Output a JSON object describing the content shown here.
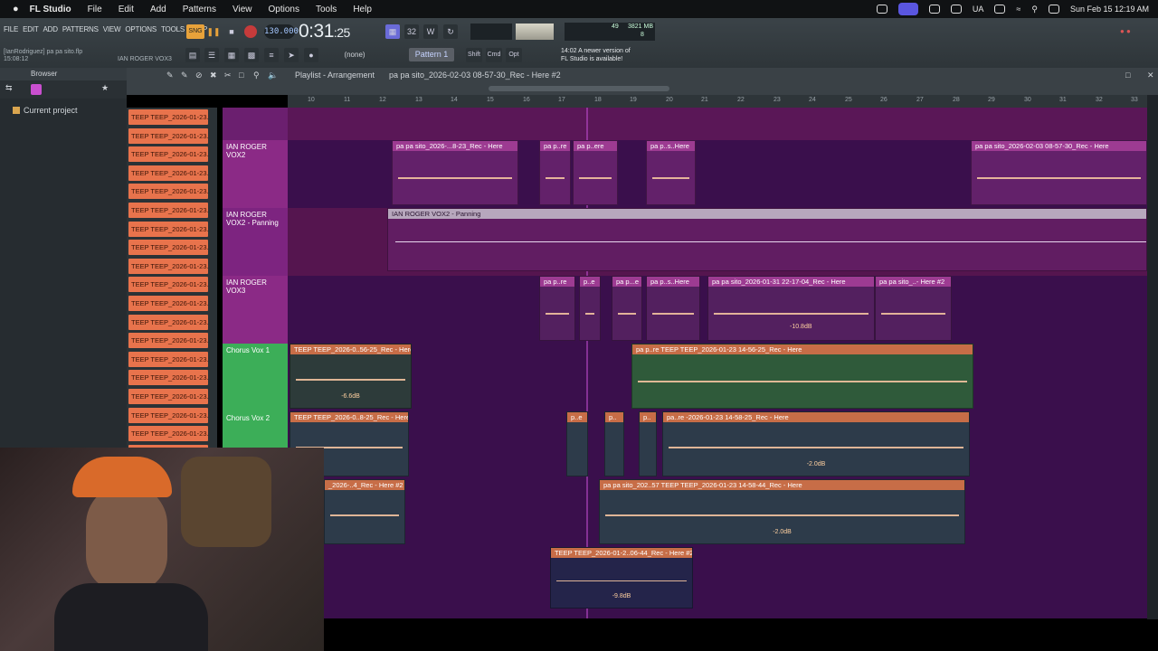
{
  "mac": {
    "app": "FL Studio",
    "menus": [
      "File",
      "Edit",
      "Add",
      "Patterns",
      "View",
      "Options",
      "Tools",
      "Help"
    ],
    "lang": "UA",
    "clock": "Sun Feb 15  12:19 AM"
  },
  "fl": {
    "menu": [
      "FILE",
      "EDIT",
      "ADD",
      "PATTERNS",
      "VIEW",
      "OPTIONS",
      "TOOLS",
      "HELP"
    ],
    "tempo": "130.000",
    "time_main": "0:31",
    "time_sub": ":25",
    "cpu": "49",
    "mem": "3821 MB",
    "poly": "8",
    "pattern": "Pattern 1",
    "snap": "(none)",
    "shift": "Shift",
    "ctrl": "Cmd",
    "opt": "Opt",
    "notice_time": "14:02",
    "notice_line1": "A newer version of",
    "notice_line2": "FL Studio is available!",
    "hint_user": "[IanRodriguez] pa pa sito.flp",
    "hint_time": "15:08:12",
    "hint_track": "IAN ROGER VOX3"
  },
  "browser": {
    "title": "Browser",
    "item": "Current project"
  },
  "playlist": {
    "title": "Playlist - Arrangement",
    "subtitle": "pa pa sito_2026-02-03 08-57-30_Rec - Here #2",
    "ruler": [
      "10",
      "11",
      "12",
      "13",
      "14",
      "15",
      "16",
      "17",
      "18",
      "19",
      "20",
      "21",
      "22",
      "23",
      "24",
      "25",
      "26",
      "27",
      "28",
      "29",
      "30",
      "31",
      "32",
      "33"
    ]
  },
  "patterns": [
    "TEEP TEEP_2026-01-23...",
    "TEEP TEEP_2026-01-23...",
    "TEEP TEEP_2026-01-23...",
    "TEEP TEEP_2026-01-23...",
    "TEEP TEEP_2026-01-23...",
    "TEEP TEEP_2026-01-23...",
    "TEEP TEEP_2026-01-23...",
    "TEEP TEEP_2026-01-23...",
    "TEEP TEEP_2026-01-23...",
    "TEEP TEEP_2026-01-23...",
    "TEEP TEEP_2026-01-23...",
    "TEEP TEEP_2026-01-23...",
    "TEEP TEEP_2026-01-23...",
    "TEEP TEEP_2026-01-23...",
    "TEEP TEEP_2026-01-23...",
    "TEEP TEEP_2026-01-23...",
    "TEEP TEEP_2026-01-23...",
    "TEEP TEEP_2026-01-23...",
    "TEEP TEEP_2026-01-23..."
  ],
  "tracks": {
    "t1": "IAN ROGER VOX2",
    "t2": "IAN ROGER VOX2 - Panning",
    "t3": "IAN ROGER VOX3",
    "t4": "Chorus Vox 1",
    "t5": "Chorus Vox 2"
  },
  "clips": {
    "c1": "pa pa sito_2026-...8-23_Rec - Here",
    "c2": "pa p..re",
    "c3": "pa p..ere",
    "c4": "pa p..s..Here",
    "c5": "pa pa sito_2026-02-03 08-57-30_Rec - Here",
    "auto": "IAN ROGER VOX2 - Panning",
    "c6": "pa p..re",
    "c7": "p..e",
    "c8": "pa p...e",
    "c9": "pa p..s..Here",
    "c10": "pa pa sito_2026-01-31 22-17-04_Rec - Here",
    "c11": "pa pa sito_..- Here #2",
    "c11_db": "-10.8dB",
    "c12": "TEEP TEEP_2026-0..56-25_Rec - Here",
    "c12_db": "-6.6dB",
    "c13": "pa p..re",
    "c14": "TEEP TEEP_2026-01-23 14-56-25_Rec - Here",
    "c15": "TEEP TEEP_2026-0..8-25_Rec - Here",
    "c16": "p..e",
    "c17": "p..",
    "c18": "p..",
    "c19": "pa..re",
    "c20": "-2026-01-23 14-58-25_Rec - Here",
    "c20_db": "-2.0dB",
    "c21": "_2026-..4_Rec - Here #2",
    "c22": "pa pa sito_202..57",
    "c23": "TEEP TEEP_2026-01-23 14-58-44_Rec - Here",
    "c23_db": "-2.0dB",
    "c24": "TEEP TEEP_2026-01-2..06-44_Rec - Here #2",
    "c24_db": "-9.8dB"
  }
}
